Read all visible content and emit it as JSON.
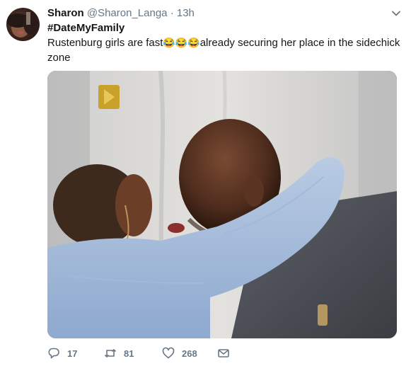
{
  "tweet": {
    "author_name": "Sharon",
    "author_handle": "@Sharon_Langa",
    "separator": "·",
    "timestamp": "13h",
    "hashtag": "#DateMyFamily",
    "text_before_emoji": "Rustenburg girls are fast",
    "emoji": "😂😂😂",
    "text_after_emoji": "already securing her place in the sidechick zone"
  },
  "media": {
    "image_name": "tv-screenshot-embrace-photo"
  },
  "actions": {
    "reply_count": "17",
    "retweet_count": "81",
    "like_count": "268"
  },
  "icons": {
    "reply": "reply-icon",
    "retweet": "retweet-icon",
    "like": "heart-icon",
    "dm": "envelope-icon",
    "menu": "chevron-down-icon"
  },
  "colors": {
    "text": "#14171a",
    "secondary": "#657786",
    "background": "#ffffff"
  }
}
